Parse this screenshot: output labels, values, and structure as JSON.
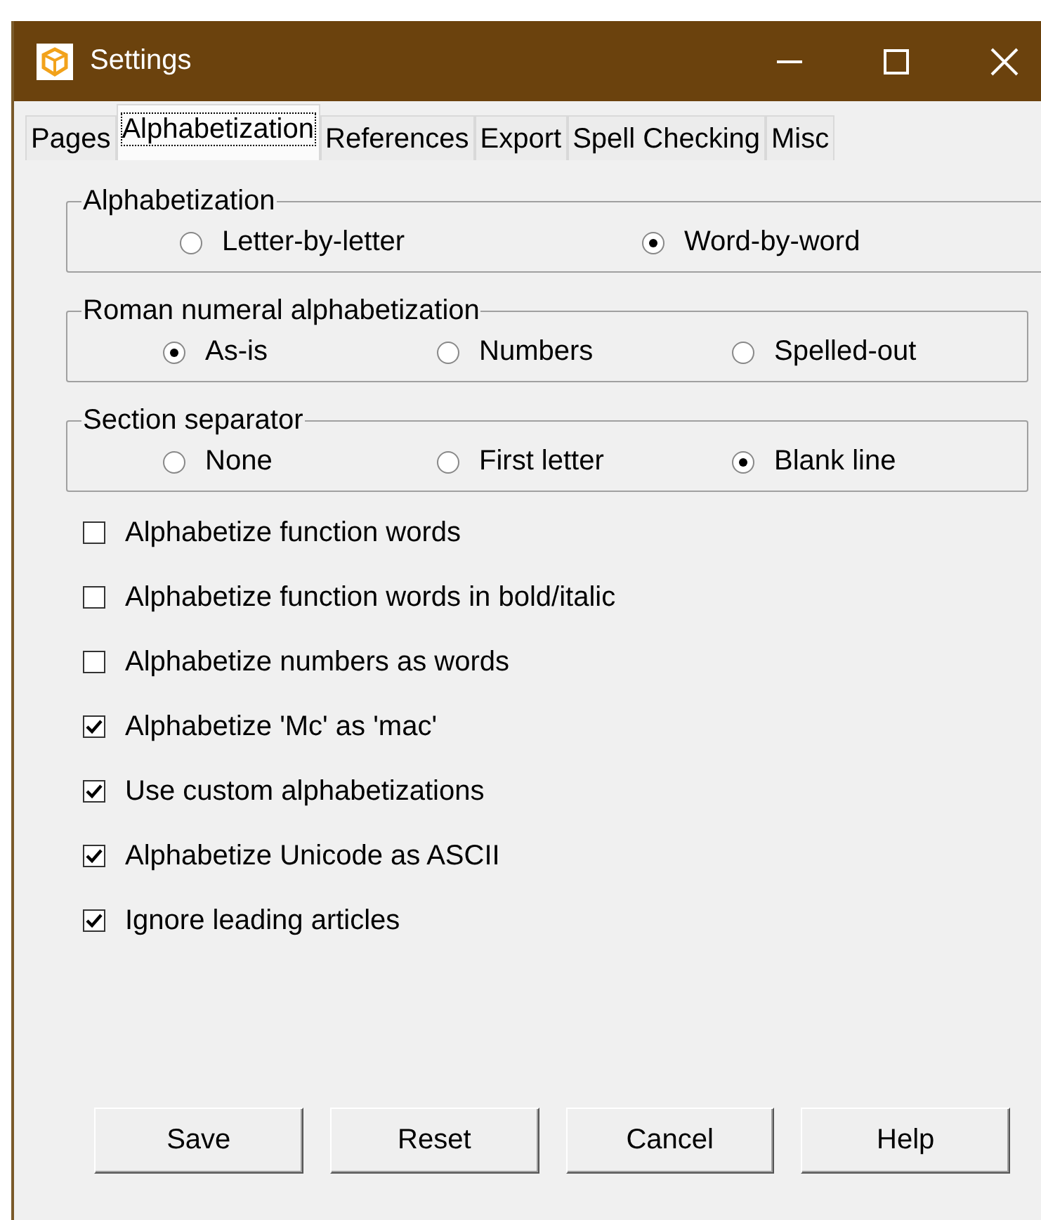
{
  "window": {
    "title": "Settings"
  },
  "tabs": [
    {
      "label": "Pages",
      "selected": false
    },
    {
      "label": "Alphabetization",
      "selected": true
    },
    {
      "label": "References",
      "selected": false
    },
    {
      "label": "Export",
      "selected": false
    },
    {
      "label": "Spell Checking",
      "selected": false
    },
    {
      "label": "Misc",
      "selected": false
    }
  ],
  "groups": [
    {
      "title": "Alphabetization",
      "options": [
        {
          "label": "Letter-by-letter",
          "selected": false
        },
        {
          "label": "Word-by-word",
          "selected": true
        }
      ]
    },
    {
      "title": "Roman numeral alphabetization",
      "options": [
        {
          "label": "As-is",
          "selected": true
        },
        {
          "label": "Numbers",
          "selected": false
        },
        {
          "label": "Spelled-out",
          "selected": false
        }
      ]
    },
    {
      "title": "Section separator",
      "options": [
        {
          "label": "None",
          "selected": false
        },
        {
          "label": "First letter",
          "selected": false
        },
        {
          "label": "Blank line",
          "selected": true
        }
      ]
    }
  ],
  "checkboxes": [
    {
      "label": "Alphabetize function words",
      "checked": false
    },
    {
      "label": "Alphabetize function words in bold/italic",
      "checked": false
    },
    {
      "label": "Alphabetize numbers as words",
      "checked": false
    },
    {
      "label": "Alphabetize 'Mc' as 'mac'",
      "checked": true
    },
    {
      "label": "Use custom alphabetizations",
      "checked": true
    },
    {
      "label": "Alphabetize Unicode as ASCII",
      "checked": true
    },
    {
      "label": "Ignore leading articles",
      "checked": true
    }
  ],
  "buttons": [
    "Save",
    "Reset",
    "Cancel",
    "Help"
  ]
}
